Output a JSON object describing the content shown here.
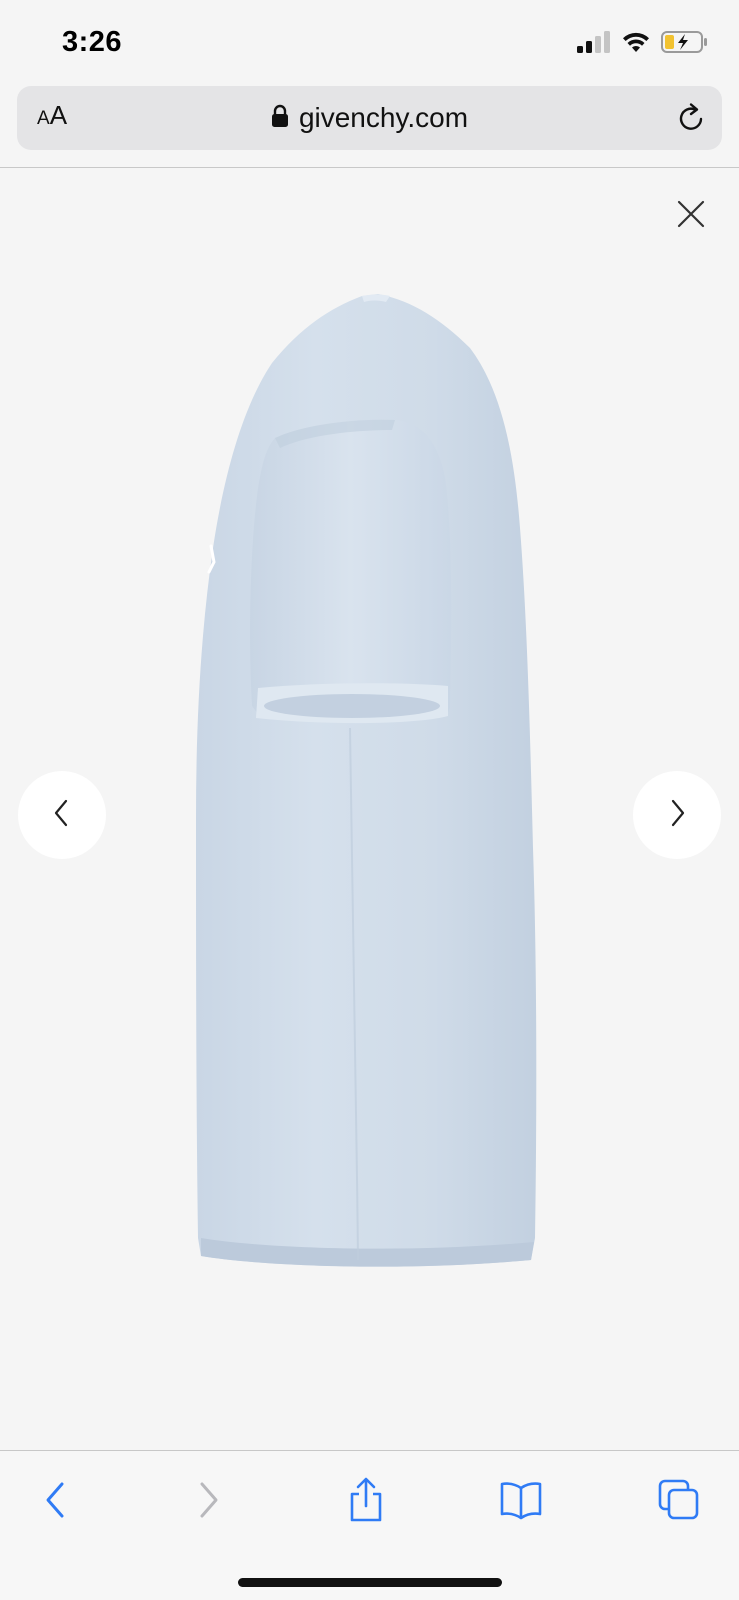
{
  "status_bar": {
    "time": "3:26",
    "icons": [
      "signal-icon",
      "wifi-icon",
      "battery-charging-icon"
    ]
  },
  "browser": {
    "text_size_button": {
      "small": "A",
      "large": "A"
    },
    "url": "givenchy.com",
    "icons": [
      "lock-icon",
      "reload-icon"
    ]
  },
  "viewer": {
    "icons": [
      "close-icon",
      "chevron-left-icon",
      "chevron-right-icon"
    ],
    "product_color": "#cfdbe8"
  },
  "toolbar": {
    "icons": [
      "back-icon",
      "forward-icon",
      "share-icon",
      "bookmarks-icon",
      "tabs-icon"
    ],
    "accent": "#2f7bf5",
    "disabled": "#b8b8bc"
  }
}
